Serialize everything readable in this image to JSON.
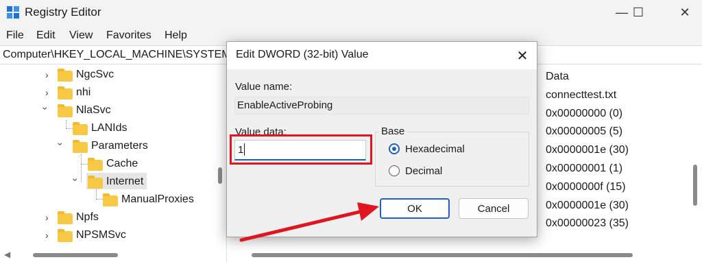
{
  "window": {
    "title": "Registry Editor",
    "controls": {
      "minimize": "—",
      "maximize": "☐",
      "close": "✕"
    }
  },
  "menu": [
    "File",
    "Edit",
    "View",
    "Favorites",
    "Help"
  ],
  "address": {
    "path": "Computer\\HKEY_LOCAL_MACHINE\\SYSTEM\\"
  },
  "tree": {
    "items": [
      {
        "label": "NgcSvc"
      },
      {
        "label": "nhi"
      },
      {
        "label": "NlaSvc"
      },
      {
        "label": "LANIds"
      },
      {
        "label": "Parameters"
      },
      {
        "label": "Cache"
      },
      {
        "label": "Internet"
      },
      {
        "label": "ManualProxies"
      },
      {
        "label": "Npfs"
      },
      {
        "label": "NPSMSvc"
      }
    ]
  },
  "values_pane": {
    "data_header": "Data",
    "data": [
      "connecttest.txt",
      "0x00000000 (0)",
      "0x00000005 (5)",
      "0x0000001e (30)",
      "0x00000001 (1)",
      "0x0000000f (15)",
      "0x0000001e (30)",
      "0x00000023 (35)"
    ]
  },
  "dialog": {
    "title": "Edit DWORD (32-bit) Value",
    "close": "✕",
    "value_name_label": "Value name:",
    "value_name": "EnableActiveProbing",
    "value_data_label": "Value data:",
    "value_data": "1",
    "base_label": "Base",
    "base_options": [
      {
        "label": "Hexadecimal",
        "selected": true
      },
      {
        "label": "Decimal",
        "selected": false
      }
    ],
    "ok_label": "OK",
    "cancel_label": "Cancel"
  },
  "annotation": {
    "highlight_color": "#e0151f",
    "arrow_color": "#e0151f"
  },
  "icons": {
    "app": "registry-editor-icon",
    "folder": "folder-icon"
  }
}
